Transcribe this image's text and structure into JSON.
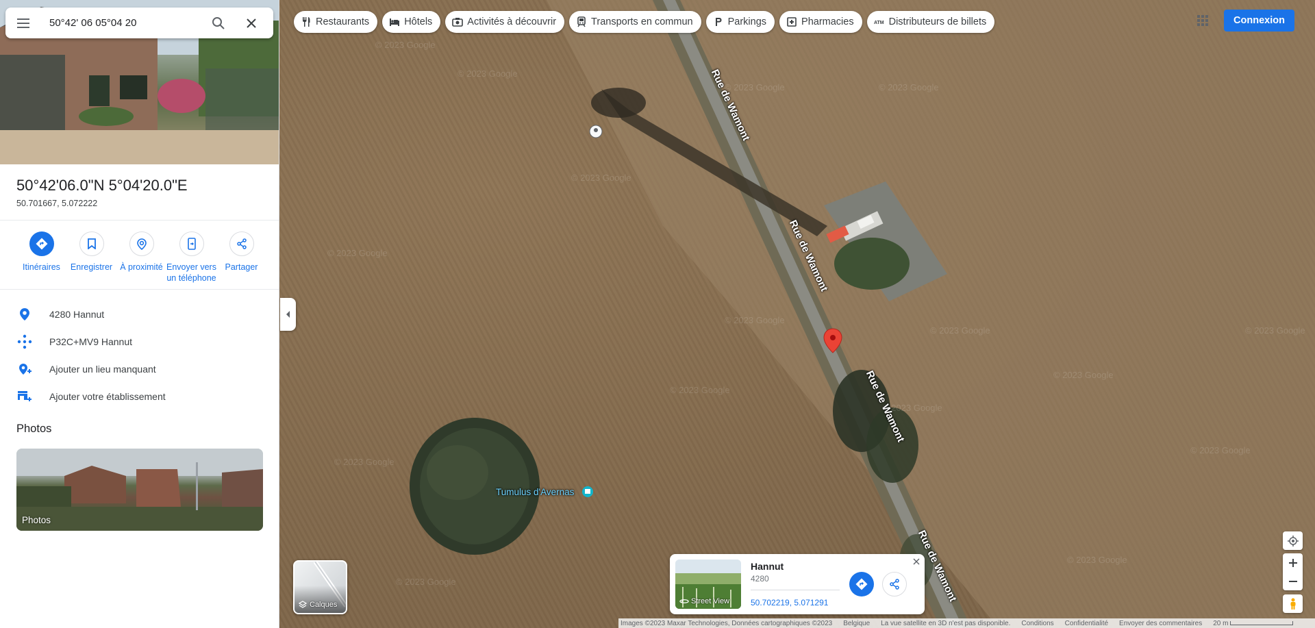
{
  "search": {
    "query": "50°42' 06 05°04 20",
    "placeholder": "Rechercher dans Google Maps"
  },
  "chips": [
    {
      "label": "Restaurants",
      "icon": "fork-knife-icon"
    },
    {
      "label": "Hôtels",
      "icon": "bed-icon"
    },
    {
      "label": "Activités à découvrir",
      "icon": "camera-icon"
    },
    {
      "label": "Transports en commun",
      "icon": "train-icon"
    },
    {
      "label": "Parkings",
      "icon": "parking-icon"
    },
    {
      "label": "Pharmacies",
      "icon": "pharmacy-icon"
    },
    {
      "label": "Distributeurs de billets",
      "icon": "atm-icon"
    }
  ],
  "header": {
    "signin_label": "Connexion"
  },
  "place": {
    "title": "50°42'06.0\"N 5°04'20.0\"E",
    "decimal": "50.701667, 5.072222"
  },
  "actions": [
    {
      "label": "Itinéraires",
      "icon": "directions-icon"
    },
    {
      "label": "Enregistrer",
      "icon": "bookmark-icon"
    },
    {
      "label": "À proximité",
      "icon": "nearby-icon"
    },
    {
      "label": "Envoyer vers un téléphone",
      "icon": "send-to-phone-icon"
    },
    {
      "label": "Partager",
      "icon": "share-icon"
    }
  ],
  "info_rows": [
    {
      "text": "4280 Hannut",
      "icon": "location-pin-icon"
    },
    {
      "text": "P32C+MV9 Hannut",
      "icon": "plus-code-icon"
    },
    {
      "text": "Ajouter un lieu manquant",
      "icon": "add-place-icon"
    },
    {
      "text": "Ajouter votre établissement",
      "icon": "add-business-icon"
    }
  ],
  "photos": {
    "heading": "Photos",
    "card_label": "Photos"
  },
  "map": {
    "road_name": "Rue de Wamont",
    "poi_name": "Tumulus d'Avernas",
    "watermark": "© 2023 Google",
    "layers_label": "Calques"
  },
  "infocard": {
    "title": "Hannut",
    "subtitle": "4280",
    "coords": "50.702219, 5.071291",
    "streetview_label": "Street View"
  },
  "footer": {
    "imagery": "Images ©2023 Maxar Technologies, Données cartographiques ©2023",
    "country": "Belgique",
    "notice": "La vue satellite en 3D n'est pas disponible.",
    "terms": "Conditions",
    "privacy": "Confidentialité",
    "feedback": "Envoyer des commentaires",
    "scale": "20 m"
  },
  "colors": {
    "accent": "#1a73e8",
    "marker": "#ea4335",
    "poi": "#6dd3ff"
  }
}
